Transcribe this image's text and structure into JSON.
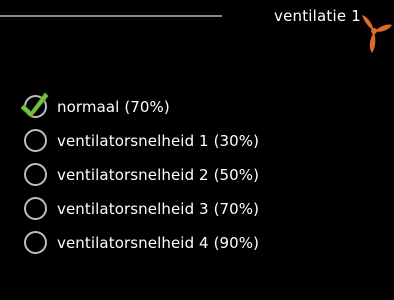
{
  "header": {
    "title": "ventilatie 1",
    "icon": "fan-icon",
    "accent_color": "#e06a2c"
  },
  "options": [
    {
      "label": "normaal (70%)",
      "selected": true
    },
    {
      "label": "ventilatorsnelheid 1 (30%)",
      "selected": false
    },
    {
      "label": "ventilatorsnelheid 2 (50%)",
      "selected": false
    },
    {
      "label": "ventilatorsnelheid 3 (70%)",
      "selected": false
    },
    {
      "label": "ventilatorsnelheid 4 (90%)",
      "selected": false
    }
  ],
  "colors": {
    "background": "#000000",
    "check_green": "#7cc242",
    "radio_gray": "#bdbdbd"
  }
}
